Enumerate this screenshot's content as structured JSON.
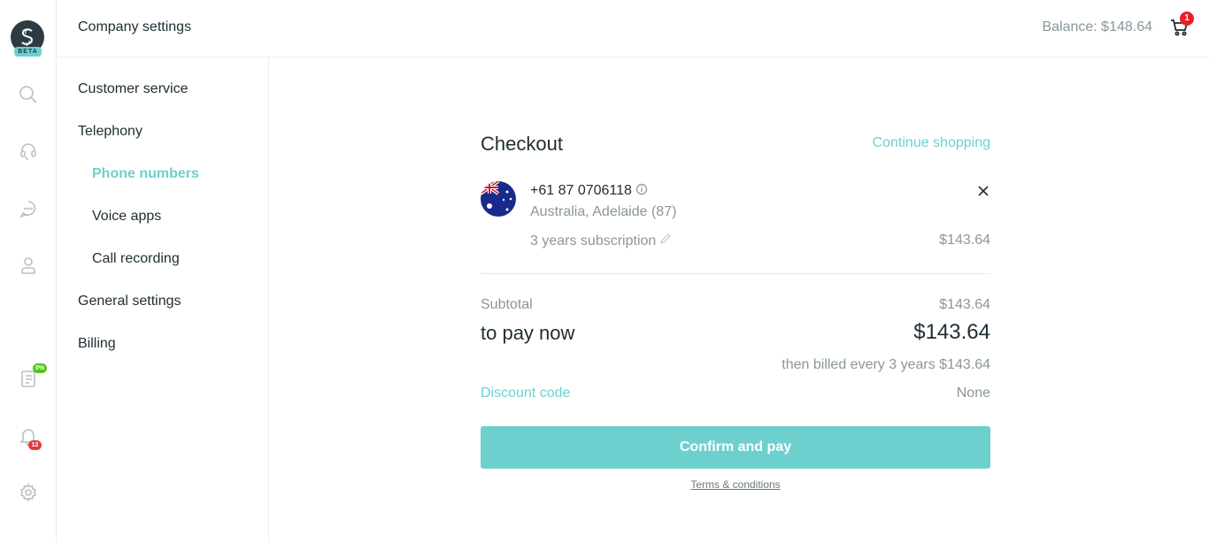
{
  "rail": {
    "beta_label": "BETA",
    "icons": [
      "search-icon",
      "headset-icon",
      "chat-icon",
      "user-icon",
      "report-icon",
      "bell-icon",
      "gear-icon"
    ],
    "report_badge": "0%",
    "notifications_badge": "12"
  },
  "header": {
    "title": "Company settings",
    "balance": "Balance:  $148.64",
    "cart_count": "1"
  },
  "menu": {
    "items": [
      {
        "label": "Customer service"
      },
      {
        "label": "Telephony"
      },
      {
        "label": "Phone numbers"
      },
      {
        "label": "Voice apps"
      },
      {
        "label": "Call recording"
      },
      {
        "label": "General settings"
      },
      {
        "label": "Billing"
      }
    ],
    "active": "Phone numbers"
  },
  "checkout": {
    "title": "Checkout",
    "continue_label": "Continue shopping",
    "item": {
      "number": "+61 87 0706118",
      "location": "Australia, Adelaide (87)",
      "subscription": "3 years subscription",
      "price": "$143.64"
    },
    "subtotal_label": "Subtotal",
    "subtotal_value": "$143.64",
    "pay_label": "to pay now",
    "pay_value": "$143.64",
    "billed_note": "then billed every 3 years $143.64",
    "discount_label": "Discount code",
    "discount_value": "None",
    "confirm_label": "Confirm and pay",
    "terms_label": "Terms & conditions"
  },
  "colors": {
    "accent": "#6dd0cf",
    "text": "#1f2d33",
    "muted": "#8a969c",
    "badge_red": "#e23b3b",
    "badge_green": "#54c41c"
  }
}
